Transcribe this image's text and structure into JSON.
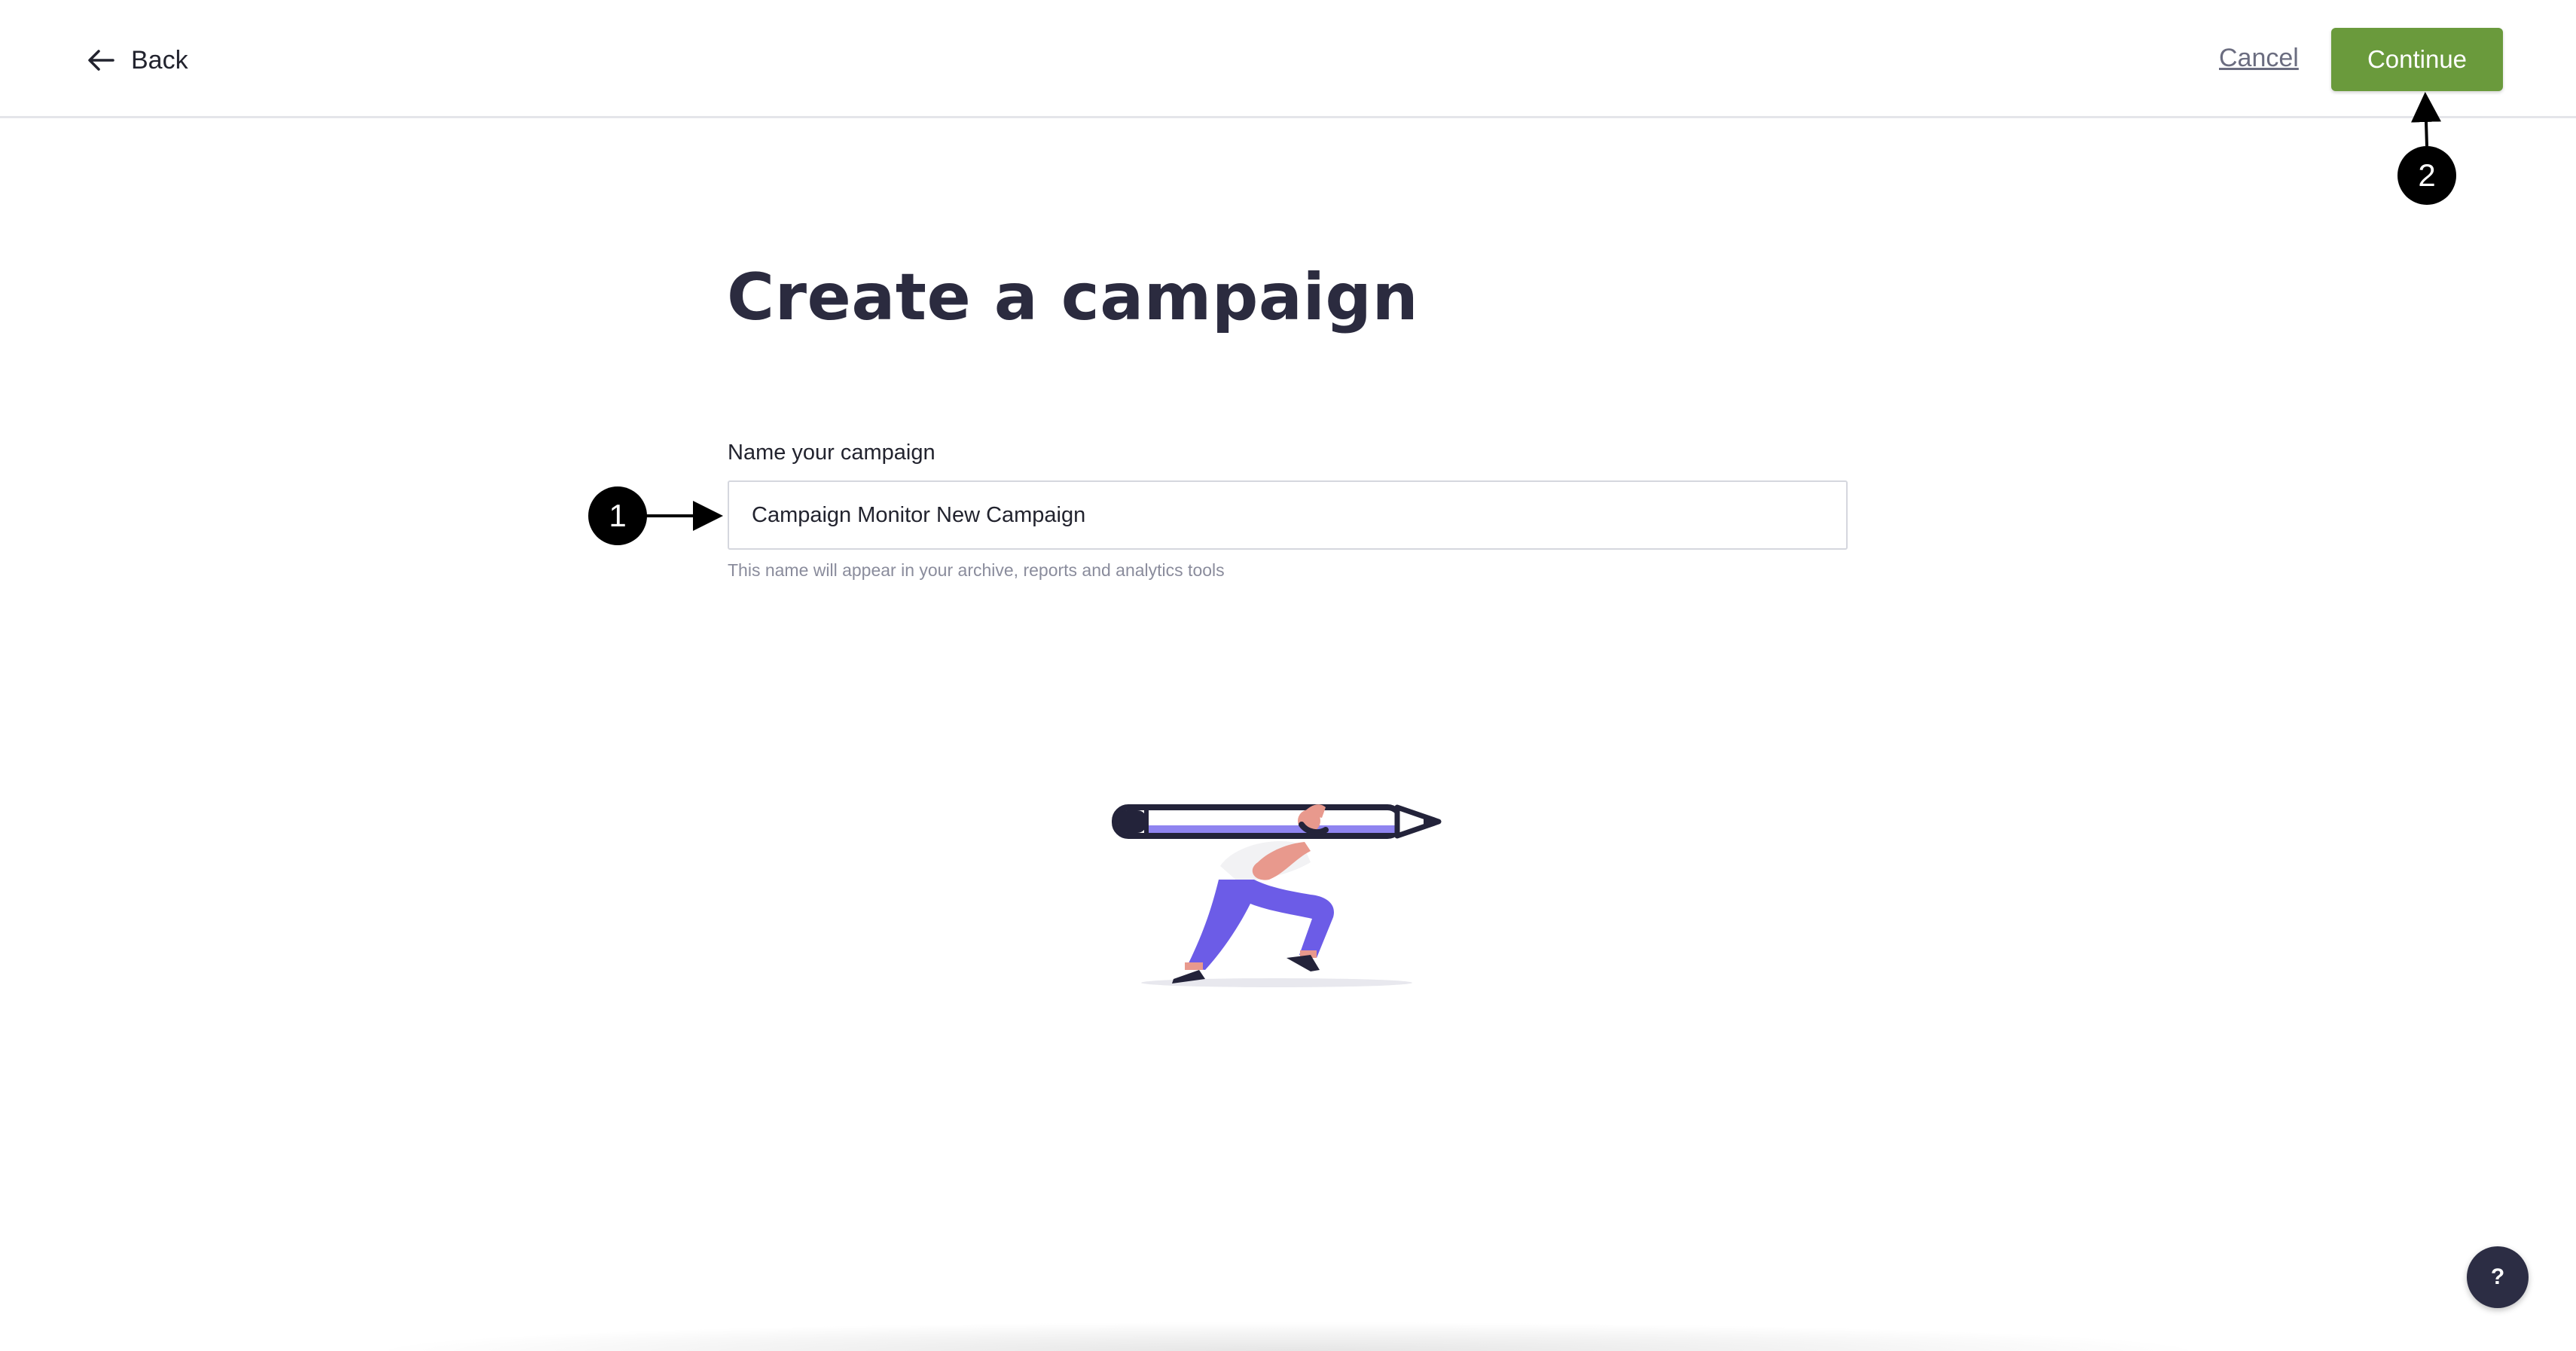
{
  "header": {
    "back_label": "Back",
    "cancel_label": "Cancel",
    "continue_label": "Continue"
  },
  "main": {
    "title": "Create a campaign",
    "name_field": {
      "label": "Name your campaign",
      "value": "Campaign Monitor New Campaign",
      "hint": "This name will appear in your archive, reports and analytics tools"
    }
  },
  "annotations": {
    "marker_1": "1",
    "marker_2": "2"
  },
  "help": {
    "label": "?"
  },
  "colors": {
    "accent": "#6a9a3c",
    "title": "#2b2b3f",
    "help_button": "#2c2d44",
    "illustration_purple": "#6c5ce7"
  },
  "icons": {
    "back": "arrow-left-icon",
    "illustration": "person-carrying-pencil-illustration"
  }
}
